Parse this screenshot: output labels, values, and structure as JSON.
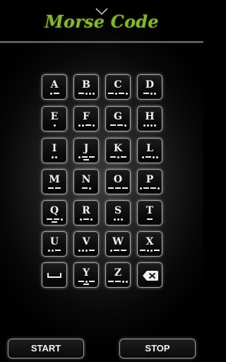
{
  "header": {
    "title": "Morse Code"
  },
  "keypad": {
    "rows": [
      [
        {
          "letter": "A",
          "code": ".-"
        },
        {
          "letter": "B",
          "code": "-..."
        },
        {
          "letter": "C",
          "code": "-.-."
        },
        {
          "letter": "D",
          "code": "-.."
        }
      ],
      [
        {
          "letter": "E",
          "code": "."
        },
        {
          "letter": "F",
          "code": "..-."
        },
        {
          "letter": "G",
          "code": "--."
        },
        {
          "letter": "H",
          "code": "...."
        }
      ],
      [
        {
          "letter": "I",
          "code": ".."
        },
        {
          "letter": "J",
          "code": ".---"
        },
        {
          "letter": "K",
          "code": "-.-"
        },
        {
          "letter": "L",
          "code": ".-.."
        }
      ],
      [
        {
          "letter": "M",
          "code": "--"
        },
        {
          "letter": "N",
          "code": "-."
        },
        {
          "letter": "O",
          "code": "---"
        },
        {
          "letter": "P",
          "code": ".--."
        }
      ],
      [
        {
          "letter": "Q",
          "code": "--.-"
        },
        {
          "letter": "R",
          "code": ".-."
        },
        {
          "letter": "S",
          "code": "..."
        },
        {
          "letter": "T",
          "code": "-"
        }
      ],
      [
        {
          "letter": "U",
          "code": "..-"
        },
        {
          "letter": "V",
          "code": "...-"
        },
        {
          "letter": "W",
          "code": ".--"
        },
        {
          "letter": "X",
          "code": "-..-"
        }
      ],
      [
        {
          "letter": "",
          "code": "",
          "special": "space",
          "icon": "space-bar-icon"
        },
        {
          "letter": "Y",
          "code": "-.--"
        },
        {
          "letter": "Z",
          "code": "--.."
        },
        {
          "letter": "",
          "code": "",
          "special": "backspace",
          "icon": "backspace-icon"
        }
      ]
    ]
  },
  "controls": {
    "start_label": "START",
    "stop_label": "STOP"
  },
  "icons": {
    "top": "chevron-down-icon"
  },
  "colors": {
    "title": "#86b43a",
    "key_border": "#a8a8a8",
    "background": "#000000"
  }
}
